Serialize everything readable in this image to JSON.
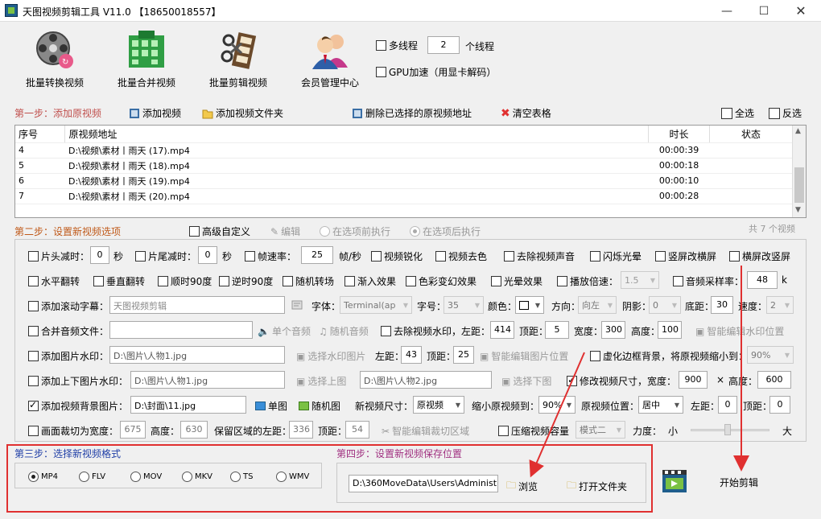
{
  "window": {
    "title": "天图视频剪辑工具 V11.0  【18650018557】",
    "min": "—",
    "max": "☐",
    "close": "✕"
  },
  "toolbar": [
    {
      "label": "批量转换视频",
      "icon": "film-reel-icon"
    },
    {
      "label": "批量合并视频",
      "icon": "merge-grid-icon"
    },
    {
      "label": "批量剪辑视频",
      "icon": "film-scissors-icon"
    },
    {
      "label": "会员管理中心",
      "icon": "users-icon"
    }
  ],
  "threads": {
    "multi_label": "多线程",
    "count": "2",
    "unit": "个线程",
    "gpu_label": "GPU加速（用显卡解码）"
  },
  "step1": {
    "label": "第一步：添加原视频",
    "add_video": "添加视频",
    "add_folder": "添加视频文件夹",
    "delete_selected": "删除已选择的原视频地址",
    "clear": "清空表格",
    "select_all": "全选",
    "invert": "反选"
  },
  "table": {
    "headers": {
      "idx": "序号",
      "path": "原视频地址",
      "dur": "时长",
      "status": "状态"
    },
    "rows": [
      {
        "idx": "4",
        "path": "D:\\视频\\素材丨雨天 (17).mp4",
        "dur": "00:00:39",
        "status": ""
      },
      {
        "idx": "5",
        "path": "D:\\视频\\素材丨雨天 (18).mp4",
        "dur": "00:00:18",
        "status": ""
      },
      {
        "idx": "6",
        "path": "D:\\视频\\素材丨雨天 (19).mp4",
        "dur": "00:00:10",
        "status": ""
      },
      {
        "idx": "7",
        "path": "D:\\视频\\素材丨雨天 (20).mp4",
        "dur": "00:00:28",
        "status": ""
      }
    ],
    "total": "共 7 个视频"
  },
  "step2": {
    "label": "第二步：设置新视频选项",
    "advanced": "高级自定义",
    "edit": "编辑",
    "before": "在选项前执行",
    "after": "在选项后执行"
  },
  "row1": {
    "head_cut": "片头减时：",
    "head_val": "0",
    "sec1": "秒",
    "tail_cut": "片尾减时：",
    "tail_val": "0",
    "sec2": "秒",
    "fps": "帧速率：",
    "fps_val": "25",
    "fps_unit": "帧/秒",
    "sharpen": "视频锐化",
    "decolor": "视频去色",
    "mute": "去除视频声音",
    "flash": "闪烁光晕",
    "v2h": "竖屏改横屏",
    "h2v": "横屏改竖屏"
  },
  "row2": {
    "hflip": "水平翻转",
    "vflip": "垂直翻转",
    "cw90": "顺时90度",
    "ccw90": "逆时90度",
    "random_trans": "随机转场",
    "fade_in": "渐入效果",
    "color_fx": "色彩变幻效果",
    "light_fx": "光晕效果",
    "speed": "播放倍速：",
    "speed_val": "1.5",
    "sample": "音频采样率：",
    "sample_val": "48",
    "sample_unit": "k"
  },
  "row3": {
    "subtitle": "添加滚动字幕：",
    "subtitle_val": "天图视频剪辑",
    "font": "字体：",
    "font_val": "Terminal(ap",
    "size": "字号：",
    "size_val": "35",
    "color": "颜色：",
    "direction": "方向：",
    "direction_val": "向左",
    "shadow": "阴影：",
    "shadow_val": "0",
    "bottom": "底距：",
    "bottom_val": "30",
    "speed": "速度：",
    "speed_val": "2"
  },
  "row4": {
    "merge_audio": "合并音频文件：",
    "single_audio": "单个音频",
    "random_audio": "随机音频",
    "remove_wm": "去除视频水印，左距：",
    "left_val": "414",
    "top": "顶距：",
    "top_val": "5",
    "width": "宽度：",
    "width_val": "300",
    "height": "高度：",
    "height_val": "100",
    "smart_wm": "智能编辑水印位置"
  },
  "row5": {
    "img_wm": "添加图片水印：",
    "img_path": "D:\\图片\\人物1.jpg",
    "choose_wm": "选择水印图片",
    "left": "左距：",
    "left_val": "43",
    "top": "顶距：",
    "top_val": "25",
    "smart_img": "智能编辑图片位置",
    "blur_bg": "虚化边框背景，将原视频缩小到：",
    "blur_val": "90%"
  },
  "row6": {
    "updown": "添加上下图片水印：",
    "up_path": "D:\\图片\\人物1.jpg",
    "choose_up": "选择上图",
    "down_path": "D:\\图片\\人物2.jpg",
    "choose_down": "选择下图",
    "resize": "修改视频尺寸，宽度：",
    "w_val": "900",
    "times": "×",
    "h": "高度：",
    "h_val": "600"
  },
  "row7": {
    "bg_img": "添加视频背景图片：",
    "bg_path": "D:\\封面\\11.jpg",
    "single": "单图",
    "random": "随机图",
    "new_size": "新视频尺寸：",
    "new_size_val": "原视频",
    "shrink": "缩小原视频到：",
    "shrink_val": "90%",
    "pos": "原视频位置：",
    "pos_val": "居中",
    "left": "左距：",
    "left_val": "0",
    "top": "顶距：",
    "top_val": "0"
  },
  "row8": {
    "crop": "画面裁切为宽度：",
    "crop_w": "675",
    "height": "高度：",
    "crop_h": "630",
    "keep_left": "保留区域的左距：",
    "left_val": "336",
    "top": "顶距：",
    "top_val": "54",
    "smart_crop": "智能编辑裁切区域",
    "compress": "压缩视频容量",
    "mode_val": "模式二",
    "force": "力度：",
    "small": "小",
    "big": "大"
  },
  "step3": {
    "label": "第三步：选择新视频格式",
    "formats": [
      "MP4",
      "FLV",
      "MOV",
      "MKV",
      "TS",
      "WMV"
    ]
  },
  "step4": {
    "label": "第四步：设置新视频保存位置",
    "path": "D:\\360MoveData\\Users\\Administr",
    "browse": "浏览",
    "open_folder": "打开文件夹"
  },
  "start": {
    "label": "开始剪辑"
  },
  "colors": {
    "accent_red": "#e03030",
    "step_red": "#c0504d",
    "step_blue": "#1f3ea6",
    "step_purple": "#a03080"
  }
}
